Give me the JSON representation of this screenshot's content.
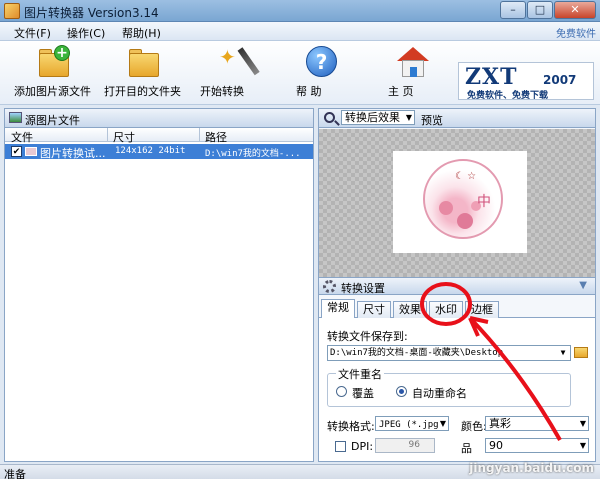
{
  "window": {
    "title": "图片转换器 Version3.14",
    "minimize_glyph": "–",
    "maximize_glyph": "□",
    "close_glyph": "✕"
  },
  "menubar": {
    "items": [
      {
        "label": "文件(F)"
      },
      {
        "label": "操作(C)"
      },
      {
        "label": "帮助(H)"
      }
    ],
    "right_link": "免费软件"
  },
  "toolbar": {
    "add_source_label": "添加图片源文件",
    "open_dest_label": "打开目的文件夹",
    "start_convert_label": "开始转换",
    "help_label": "帮 助",
    "home_label": "主 页",
    "help_glyph": "?",
    "plus_glyph": "+",
    "star_glyph": "✦"
  },
  "logo": {
    "text": "ZXT",
    "year": "2007",
    "slogan": "免费软件、免费下载"
  },
  "source_panel": {
    "title": "源图片文件",
    "columns": [
      "文件",
      "尺寸",
      "路径"
    ],
    "rows": [
      {
        "checked": true,
        "check_glyph": "✔",
        "file": "图片转换试...",
        "size": "124x162  24bit",
        "path": "D:\\win7我的文档-..."
      }
    ]
  },
  "preview_panel": {
    "effect_select": "转换后效果",
    "preview_label": "预览",
    "seal_char": "中",
    "seal_moon": "☾ ☆"
  },
  "convert_panel": {
    "title": "转换设置",
    "collapse_glyph": "▼",
    "tabs": [
      "常规",
      "尺寸",
      "效果",
      "水印",
      "边框"
    ],
    "active_tab": "常规",
    "save_to_label": "转换文件保存到:",
    "save_path": "D:\\win7我的文档-桌面-收藏夹\\Desktop",
    "rename_legend": "文件重名",
    "rename_options": [
      "覆盖",
      "自动重命名"
    ],
    "rename_selected": "自动重命名",
    "format_label": "转换格式:",
    "format_value": "JPEG (*.jpg",
    "color_label": "颜色:",
    "color_value": "真彩",
    "dpi_label": "DPI:",
    "dpi_value": "96",
    "dpi_checked": false,
    "quality_label": "品",
    "quality_value": "90",
    "dropdown_glyph": "▼"
  },
  "status": {
    "text": "准备"
  },
  "watermark": {
    "text": "jingyan.baidu.com"
  },
  "colors": {
    "selection": "#3d7fd6",
    "annotation": "#e8101a",
    "logo": "#123a78"
  }
}
